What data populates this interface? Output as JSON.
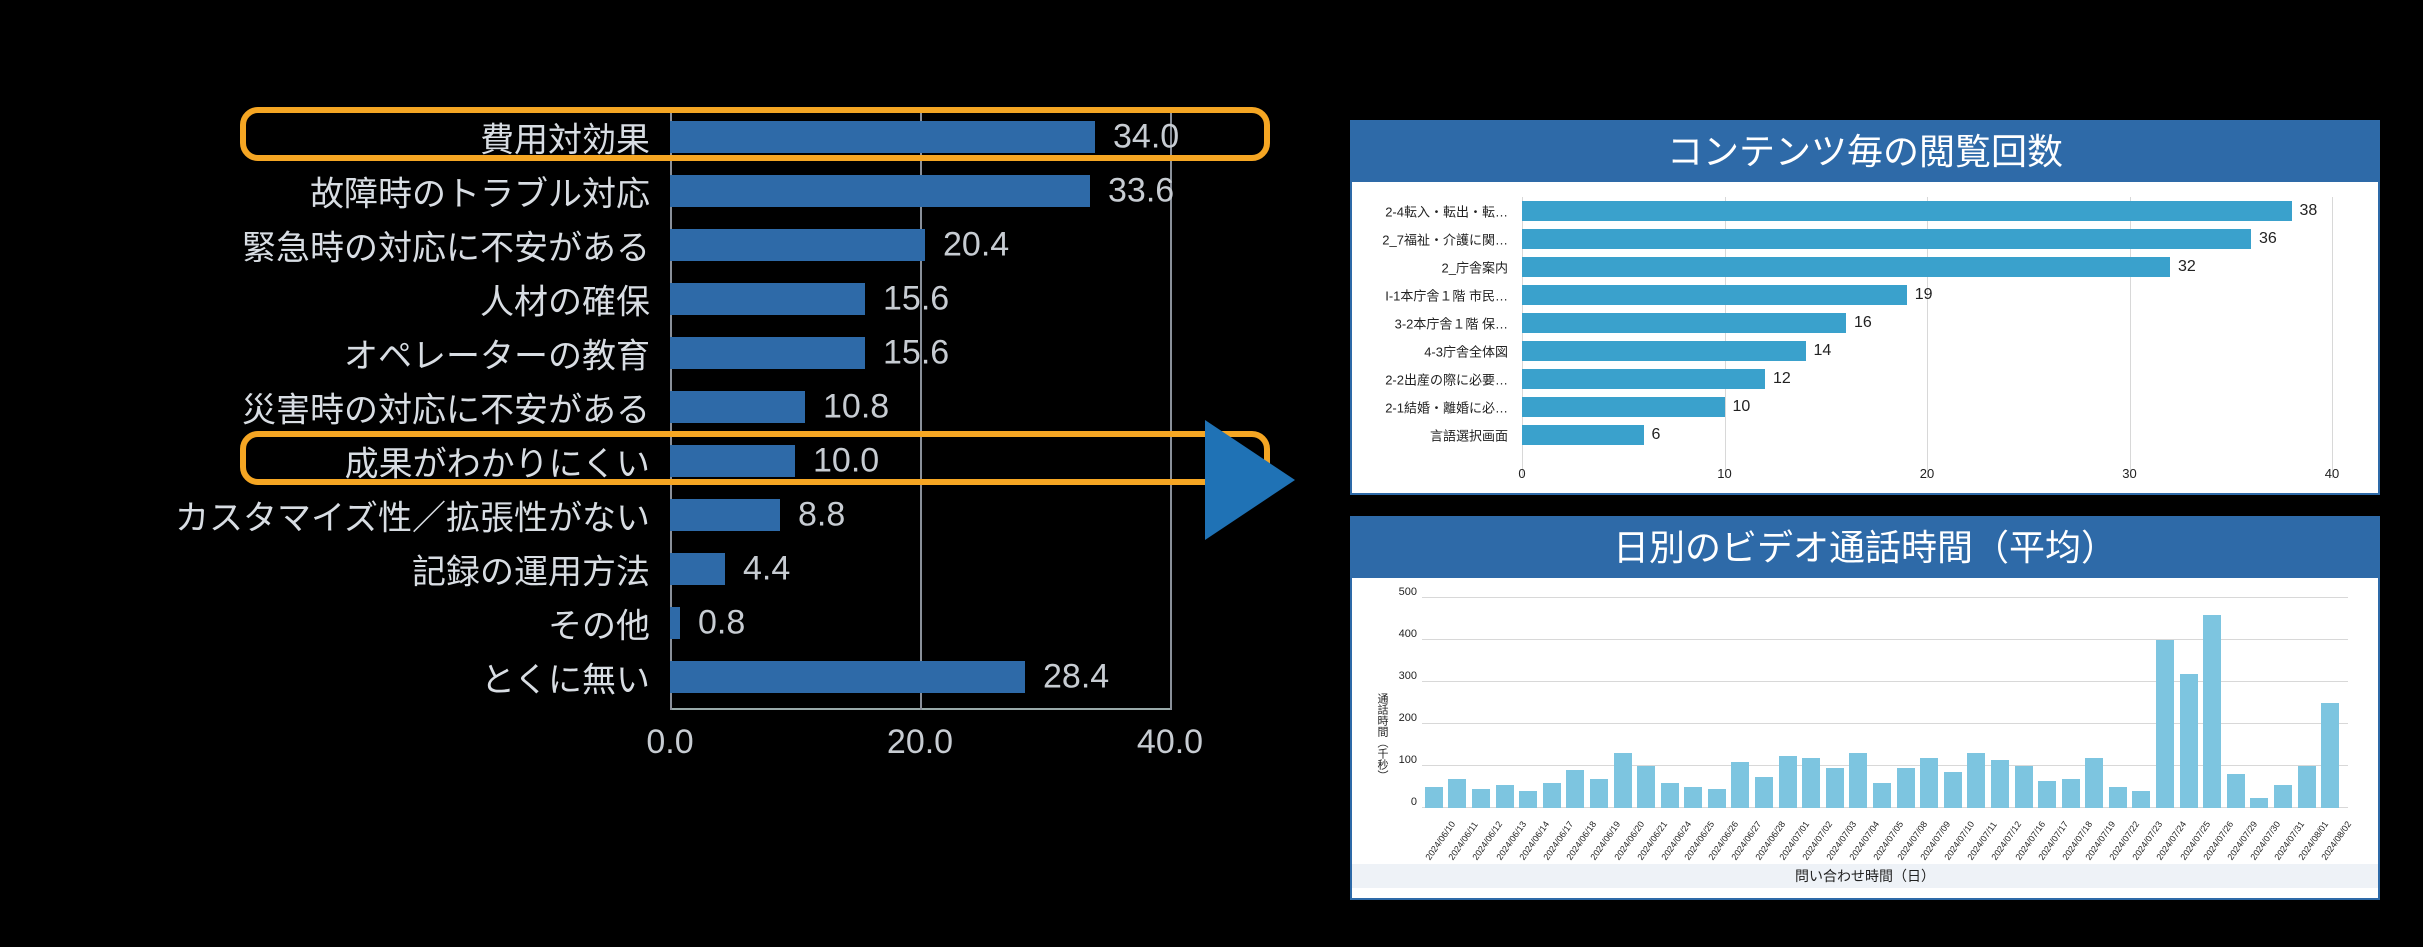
{
  "chart_data": [
    {
      "type": "bar",
      "orientation": "horizontal",
      "xlim": [
        0,
        40
      ],
      "xticks": [
        0.0,
        20.0,
        40.0
      ],
      "categories": [
        "費用対効果",
        "故障時のトラブル対応",
        "緊急時の対応に不安がある",
        "人材の確保",
        "オペレーターの教育",
        "災害時の対応に不安がある",
        "成果がわかりにくい",
        "カスタマイズ性／拡張性がない",
        "記録の運用方法",
        "その他",
        "とくに無い"
      ],
      "values": [
        34.0,
        33.6,
        20.4,
        15.6,
        15.6,
        10.8,
        10.0,
        8.8,
        4.4,
        0.8,
        28.4
      ],
      "highlight_rows": [
        0,
        6
      ],
      "highlight_color": "#f5a623",
      "bar_color": "#2e6aa8"
    },
    {
      "type": "bar",
      "orientation": "horizontal",
      "title": "コンテンツ毎の閲覧回数",
      "xlim": [
        0,
        40
      ],
      "xticks": [
        0,
        10,
        20,
        30,
        40
      ],
      "categories": [
        "2-4転入・転出・転…",
        "2_7福祉・介護に関…",
        "2_庁舎案内",
        "I-1本庁舎１階 市民…",
        "3-2本庁舎１階 保…",
        "4-3庁舎全体図",
        "2-2出産の際に必要…",
        "2-1結婚・離婚に必…",
        "言語選択画面"
      ],
      "values": [
        38,
        36,
        32,
        19,
        16,
        14,
        12,
        10,
        6
      ],
      "bar_color": "#3aa1cc"
    },
    {
      "type": "bar",
      "title": "日別のビデオ通話時間（平均）",
      "ylabel": "通話時間（千秒）",
      "xlabel": "問い合わせ時間（日）",
      "ylim": [
        0,
        500
      ],
      "yticks": [
        0,
        100,
        200,
        300,
        400,
        500
      ],
      "categories": [
        "2024/06/10",
        "2024/06/11",
        "2024/06/12",
        "2024/06/13",
        "2024/06/14",
        "2024/06/17",
        "2024/06/18",
        "2024/06/19",
        "2024/06/20",
        "2024/06/21",
        "2024/06/24",
        "2024/06/25",
        "2024/06/26",
        "2024/06/27",
        "2024/06/28",
        "2024/07/01",
        "2024/07/02",
        "2024/07/03",
        "2024/07/04",
        "2024/07/05",
        "2024/07/08",
        "2024/07/09",
        "2024/07/10",
        "2024/07/11",
        "2024/07/12",
        "2024/07/16",
        "2024/07/17",
        "2024/07/18",
        "2024/07/19",
        "2024/07/22",
        "2024/07/23",
        "2024/07/24",
        "2024/07/25",
        "2024/07/26",
        "2024/07/29",
        "2024/07/30",
        "2024/07/31",
        "2024/08/01",
        "2024/08/02"
      ],
      "values": [
        50,
        70,
        45,
        55,
        40,
        60,
        90,
        70,
        130,
        100,
        60,
        50,
        45,
        110,
        75,
        125,
        120,
        95,
        130,
        60,
        95,
        120,
        85,
        130,
        115,
        100,
        65,
        70,
        120,
        50,
        40,
        400,
        320,
        460,
        80,
        25,
        55,
        100,
        250
      ],
      "bar_color": "#7dc5e0"
    }
  ]
}
